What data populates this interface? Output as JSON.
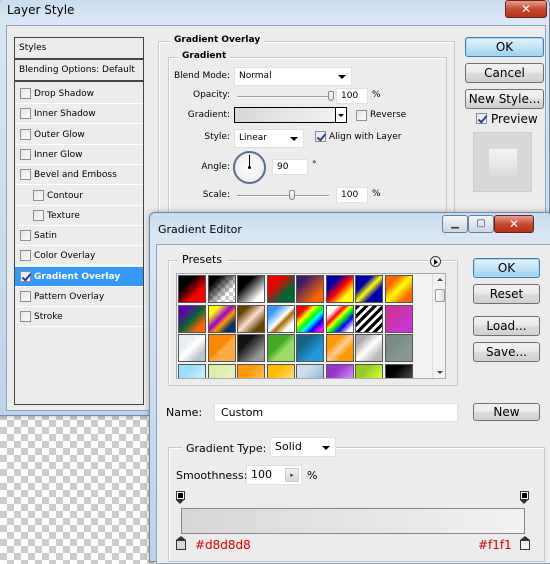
{
  "layer_style": {
    "title": "Layer Style",
    "close_label": "x",
    "styles_list": {
      "header": "Styles",
      "blending": "Blending Options: Default",
      "items": [
        {
          "label": "Drop Shadow",
          "checked": false,
          "indent": false
        },
        {
          "label": "Inner Shadow",
          "checked": false,
          "indent": false
        },
        {
          "label": "Outer Glow",
          "checked": false,
          "indent": false
        },
        {
          "label": "Inner Glow",
          "checked": false,
          "indent": false
        },
        {
          "label": "Bevel and Emboss",
          "checked": false,
          "indent": false
        },
        {
          "label": "Contour",
          "checked": false,
          "indent": true
        },
        {
          "label": "Texture",
          "checked": false,
          "indent": true
        },
        {
          "label": "Satin",
          "checked": false,
          "indent": false
        },
        {
          "label": "Color Overlay",
          "checked": false,
          "indent": false
        },
        {
          "label": "Gradient Overlay",
          "checked": true,
          "indent": false,
          "selected": true
        },
        {
          "label": "Pattern Overlay",
          "checked": false,
          "indent": false
        },
        {
          "label": "Stroke",
          "checked": false,
          "indent": false
        }
      ]
    },
    "panel": {
      "section_title": "Gradient Overlay",
      "group_title": "Gradient",
      "blend_mode_label": "Blend Mode:",
      "blend_mode_value": "Normal",
      "opacity_label": "Opacity:",
      "opacity_value": "100",
      "opacity_percent": 100,
      "gradient_label": "Gradient:",
      "reverse_label": "Reverse",
      "reverse_checked": false,
      "style_label": "Style:",
      "style_value": "Linear",
      "align_label": "Align with Layer",
      "align_checked": true,
      "angle_label": "Angle:",
      "angle_value": "90",
      "degree_symbol": "°",
      "scale_label": "Scale:",
      "scale_value": "100",
      "scale_percent": 100,
      "percent": "%"
    },
    "buttons": {
      "ok": "OK",
      "cancel": "Cancel",
      "new_style": "New Style...",
      "preview": "Preview"
    },
    "preview_checked": true
  },
  "gradient_editor": {
    "title": "Gradient Editor",
    "presets_label": "Presets",
    "buttons": {
      "ok": "OK",
      "reset": "Reset",
      "load": "Load...",
      "save": "Save...",
      "new": "New"
    },
    "name_label": "Name:",
    "name_value": "Custom",
    "gradient_type_label": "Gradient Type:",
    "gradient_type_value": "Solid",
    "smoothness_label": "Smoothness:",
    "smoothness_value": "100",
    "percent": "%",
    "left_stop_color": "#d8d8d8",
    "right_stop_color": "#f1f1f1",
    "left_stop_label": "#d8d8d8",
    "right_stop_label": "#f1f1",
    "presets": [
      [
        "linear-gradient(135deg,#000 30%,#f00 70%)",
        "linear-gradient(135deg,#000 20%,rgba(0,0,0,0) 70%),repeating-conic-gradient(#ccc 0 25%,#fff 0 50%) 0 0/8px 8px",
        "linear-gradient(135deg,#000 30%,#fff 80%)",
        "linear-gradient(135deg,#e00 30%,#063 70%)",
        "linear-gradient(135deg,#3a1a6a 20%,#f60 80%)",
        "linear-gradient(135deg,#00a 25%,#f00 50%,#ff0 75%)",
        "linear-gradient(135deg,#00a 30%,#ff0 50%,#00a 70%)",
        "linear-gradient(135deg,#f60 25%,#ff0 50%,#f60 80%)"
      ],
      [
        "linear-gradient(135deg,#60a 20%,#063 50%,#f60 80%)",
        "linear-gradient(135deg,#ff0 20%,#90c 45%,#f90 60%,#036 80%)",
        "linear-gradient(135deg,#640 20%,#fdc 50%,#640 80%)",
        "linear-gradient(135deg,#39f 20%,#fff 50%,#a60 60%,#fff 80%)",
        "linear-gradient(135deg,#f00 20%,#ff0 35%,#0f0 50%,#0ff 60%,#00f 75%,#f0f 90%)",
        "linear-gradient(135deg,#fff 20%,#f00 35%,#ff0 45%,#0f0 55%,#00f 70%,#fff 90%)",
        "repeating-linear-gradient(135deg,#000 0 3px,#fff 3px 6px)",
        "linear-gradient(135deg,#c39 30%,#c3c 70%)"
      ],
      [
        "linear-gradient(135deg,#e8eef2 30%,#fff 50%,#b8c4cc 80%)",
        "linear-gradient(135deg,#f80 45%,#fa4 55%)",
        "linear-gradient(135deg,#111 30%,#999 80%)",
        "linear-gradient(135deg,#4a2 40%,#9d6 60%)",
        "linear-gradient(135deg,#168 30%,#29d 70%)",
        "linear-gradient(135deg,#f90 30%,#fc9 50%,#f90 70%)",
        "linear-gradient(135deg,#aaa 20%,#fff 50%,#bbb 80%)",
        "linear-gradient(135deg,#7a8c88 30%,#889990 70%)"
      ],
      [
        "linear-gradient(135deg,#9df 30%,#cef 70%)",
        "linear-gradient(135deg,#dea 30%,#eeb 70%)",
        "linear-gradient(135deg,#f90 30%,#fb5 70%)",
        "linear-gradient(135deg,#fb0 30%,#fd6 70%)",
        "linear-gradient(135deg,#cde 30%,#9bd 70%)",
        "linear-gradient(135deg,#93c 30%,#c8f 70%)",
        "linear-gradient(135deg,#9c2 30%,#cf3 70%)",
        "linear-gradient(135deg,#000 30%,#444 70%)"
      ]
    ]
  }
}
